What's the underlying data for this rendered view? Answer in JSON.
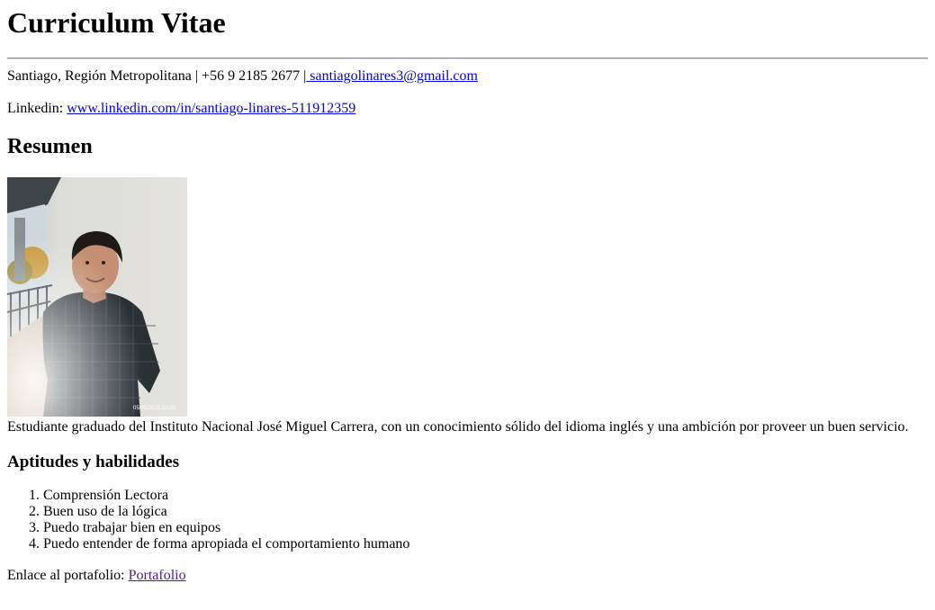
{
  "header": {
    "title": "Curriculum Vitae"
  },
  "contact": {
    "location_phone": "Santiago, Región Metropolitana | +56 9 2185 2677 |",
    "email": " santiagolinares3@gmail.com"
  },
  "linkedin": {
    "label": "Linkedin: ",
    "url_text": "www.linkedin.com/in/santiago-linares-511912359"
  },
  "summary": {
    "heading": "Resumen",
    "photo_stamp": "05/05/2025 13:00",
    "text": "Estudiante graduado del Instituto Nacional José Miguel Carrera, con un conocimiento sólido del idioma inglés y una ambición por proveer un buen servicio."
  },
  "skills": {
    "heading": "Aptitudes y habilidades",
    "items": [
      "Comprensión Lectora",
      "Buen uso de la lógica",
      "Puedo trabajar bien en equipos",
      "Puedo entender de forma apropiada el comportamiento humano"
    ]
  },
  "portfolio": {
    "label": "Enlace al portafolio: ",
    "link_text": "Portafolio"
  }
}
